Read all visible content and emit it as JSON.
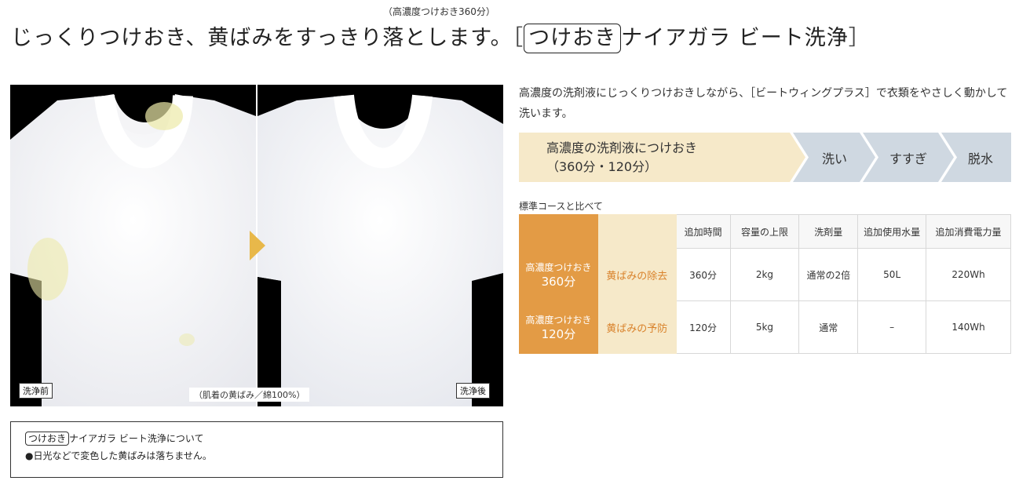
{
  "header": {
    "sub_note": "（高濃度つけおき360分）",
    "headline": "じっくりつけおき、黄ばみをすっきり落とします。",
    "bracket_open": "［",
    "badge": "つけおき",
    "product": "ナイアガラ ビート洗浄",
    "bracket_close": "］"
  },
  "photo": {
    "before_label": "洗浄前",
    "after_label": "洗浄後",
    "caption": "（肌着の黄ばみ／綿100%）",
    "colors": {
      "arrow": "#e8b84a",
      "stain": "#eceaa8"
    }
  },
  "notice": {
    "badge": "つけおき",
    "title_rest": "ナイアガラ ビート洗浄について",
    "item": "●日光などで変色した黄ばみは落ちません。"
  },
  "description": "高濃度の洗剤液にじっくりつけおきしながら、［ビートウィングプラス］で衣類をやさしく動かして洗います。",
  "flow": {
    "step1_line1": "高濃度の洗剤液につけおき",
    "step1_line2": "（360分・120分）",
    "step2": "洗い",
    "step3": "すすぎ",
    "step4": "脱水",
    "colors": {
      "first": "#f6e9c9",
      "rest": "#cfd8e1"
    }
  },
  "table": {
    "caption": "標準コースと比べて",
    "headers": [
      "追加時間",
      "容量の上限",
      "洗剤量",
      "追加使用水量",
      "追加消費電力量"
    ],
    "rows": [
      {
        "label_top": "高濃度つけおき",
        "label_big": "360分",
        "effect": "黄ばみの除去",
        "cells": [
          "360分",
          "2kg",
          "通常の2倍",
          "50L",
          "220Wh"
        ]
      },
      {
        "label_top": "高濃度つけおき",
        "label_big": "120分",
        "effect": "黄ばみの予防",
        "cells": [
          "120分",
          "5kg",
          "通常",
          "–",
          "140Wh"
        ]
      }
    ],
    "colors": {
      "label_bg": "#e39b45",
      "effect_bg": "#f6e9c9",
      "effect_text": "#d9822b"
    }
  }
}
